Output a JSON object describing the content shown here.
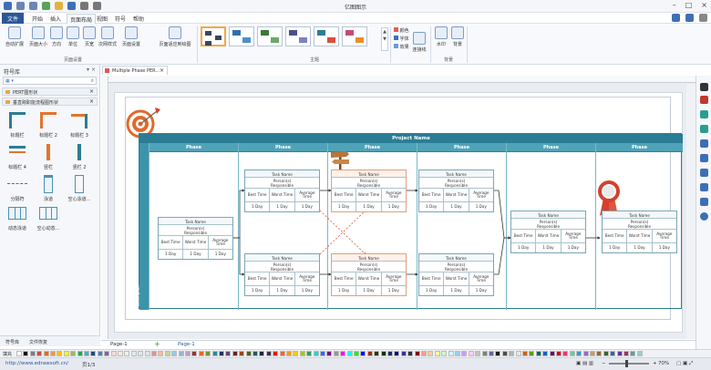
{
  "app": {
    "title": "亿图图示"
  },
  "menu": [
    "文件",
    "开始",
    "插入",
    "页面布局",
    "视图",
    "符号",
    "帮助"
  ],
  "ribbon": {
    "page_setup": [
      "自动扩展",
      "页面大小",
      "方向",
      "单位",
      "页宽",
      "次网样式",
      "页面设置",
      "页面适应到绘图"
    ],
    "page_setup_group": "页面设置",
    "theme_group": "主题",
    "theme_opts": [
      "颜色",
      "字体",
      "效果",
      "连接线"
    ],
    "background_btns": [
      "水印",
      "背景"
    ],
    "background_group": "背景"
  },
  "left_panel": {
    "title": "符号库",
    "libraries": [
      "PERT图形状",
      "垂直跨职能流程图形状"
    ],
    "shapes": [
      "标题栏",
      "标题栏 2",
      "标题栏 3",
      "标题栏 4",
      "竖栏",
      "竖栏 2",
      "分隔符",
      "泳道",
      "空心泳道...",
      "动态泳道",
      "空心动态..."
    ],
    "tabs": [
      "符号库",
      "文件恢复"
    ]
  },
  "document": {
    "tab": "Multiple Phase PER...",
    "page_tabs": [
      "Page-1",
      "Page-1"
    ]
  },
  "diagram": {
    "title": "Project Name",
    "phase_label": "Phase",
    "vertical_label": "Description",
    "task": {
      "name": "Task Name",
      "person": "Person(s)",
      "responsible": "Responsible",
      "best": "Best Time",
      "worst": "Worst Time",
      "avg1": "Average",
      "avg2": "Time",
      "val": "1 Day"
    }
  },
  "status": {
    "url": "http://www.edrawsoft.cn/",
    "page": "页1/3",
    "zoom": "70%"
  },
  "palette": {
    "label": "填充"
  }
}
